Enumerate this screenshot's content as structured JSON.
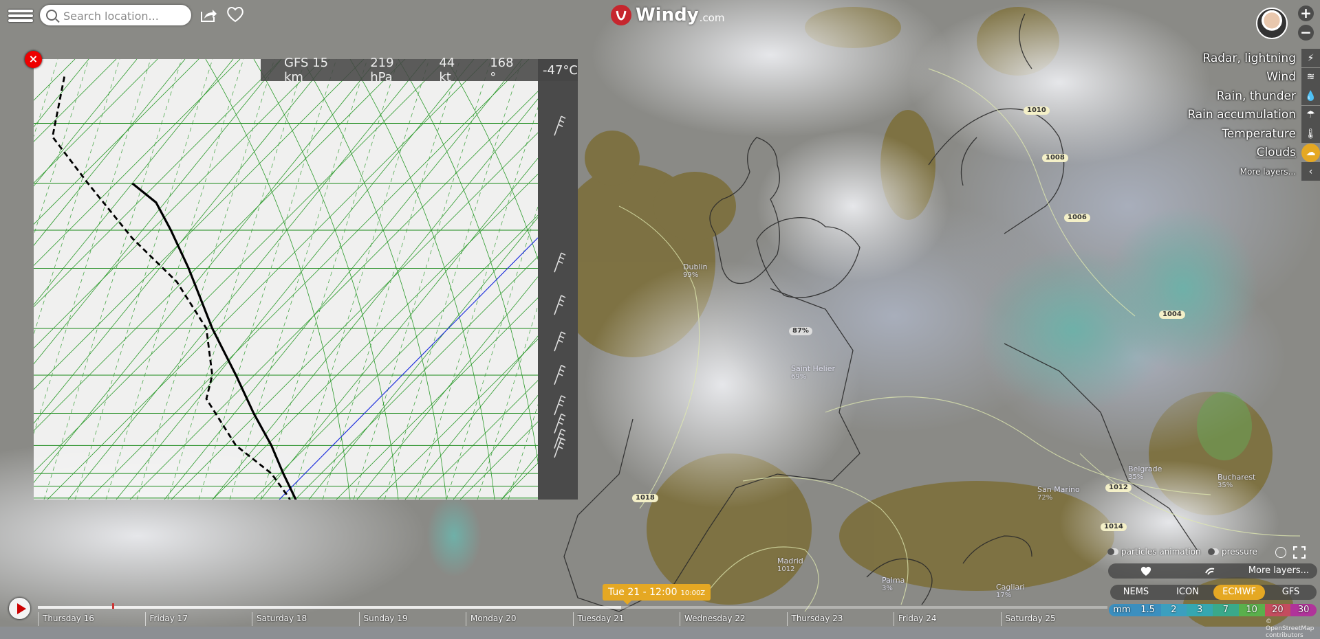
{
  "search": {
    "placeholder": "Search location..."
  },
  "logo": {
    "word": "Windy",
    "suffix": ".com"
  },
  "zoom": {
    "plus": "+",
    "minus": "−"
  },
  "layers": [
    {
      "label": "Radar, lightning",
      "icon": "radar-icon"
    },
    {
      "label": "Wind",
      "icon": "wind-icon"
    },
    {
      "label": "Rain, thunder",
      "icon": "rain-drop-icon"
    },
    {
      "label": "Rain accumulation",
      "icon": "rain-accumulation-icon"
    },
    {
      "label": "Temperature",
      "icon": "thermometer-icon"
    },
    {
      "label": "Clouds",
      "icon": "cloud-icon",
      "active": true
    },
    {
      "label": "More layers...",
      "icon": "chevron-left-icon"
    }
  ],
  "sounding": {
    "model": "GFS 15 km",
    "pressure": "219 hPa",
    "wind_speed": "44 kt",
    "wind_dir": "168 °",
    "temperature": "-47°C",
    "close_label": "×"
  },
  "chart_data": {
    "type": "line",
    "title": "",
    "xlabel": "",
    "ylabel": "",
    "series": [
      {
        "style": "solid-black",
        "points": [
          [
            -55,
            200
          ],
          [
            -47,
            219
          ],
          [
            -42,
            250
          ],
          [
            -36,
            300
          ],
          [
            -28,
            400
          ],
          [
            -20,
            500
          ],
          [
            -14,
            600
          ],
          [
            -8,
            700
          ],
          [
            -4,
            800
          ],
          [
            0,
            900
          ],
          [
            2,
            960
          ]
        ]
      },
      {
        "style": "dashed-black",
        "points": [
          [
            -78,
            120
          ],
          [
            -82,
            160
          ],
          [
            -70,
            200
          ],
          [
            -55,
            260
          ],
          [
            -40,
            320
          ],
          [
            -30,
            400
          ],
          [
            -28,
            500
          ],
          [
            -30,
            560
          ],
          [
            -20,
            700
          ],
          [
            -8,
            800
          ],
          [
            -2,
            900
          ],
          [
            0,
            960
          ]
        ]
      }
    ]
  },
  "map_labels": {
    "cities": [
      {
        "name": "Dublin",
        "val": "99%"
      },
      {
        "name": "Saint Helier",
        "val": "69%"
      },
      {
        "name": "Madrid",
        "val": "1012"
      },
      {
        "name": "Cagliari",
        "val": "17%"
      },
      {
        "name": "Palma",
        "val": "3%"
      },
      {
        "name": "Belgrade",
        "val": "35%"
      },
      {
        "name": "Bucharest",
        "val": "35%"
      },
      {
        "name": "San Marino",
        "val": "72%"
      }
    ],
    "pressure_labels": [
      "1010",
      "1008",
      "1006",
      "1018",
      "1012",
      "1014",
      "1004",
      "87%"
    ]
  },
  "toggles": {
    "particles": "particles animation",
    "pressure": "pressure"
  },
  "favbar": {
    "more": "More layers..."
  },
  "models": [
    {
      "name": "NEMS"
    },
    {
      "name": "ICON"
    },
    {
      "name": "ECMWF",
      "selected": true
    },
    {
      "name": "GFS"
    }
  ],
  "legend": {
    "items": [
      "mm",
      "1.5",
      "2",
      "3",
      "7",
      "10",
      "20",
      "30"
    ],
    "colors": [
      "#3b8fbf",
      "#3b8fbf",
      "#3b9fbf",
      "#36a7b0",
      "#3aa98a",
      "#5ab04c",
      "#c44c5e",
      "#b0339a"
    ]
  },
  "timeline": {
    "current": "Tue 21 - 12:00",
    "current_tz": "10:00Z",
    "days": [
      "Thursday 16",
      "Friday 17",
      "Saturday 18",
      "Sunday 19",
      "Monday 20",
      "Tuesday 21",
      "Wednesday 22",
      "Thursday 23",
      "Friday 24",
      "Saturday 25"
    ]
  },
  "copyright": "© OpenStreetMap contributors"
}
